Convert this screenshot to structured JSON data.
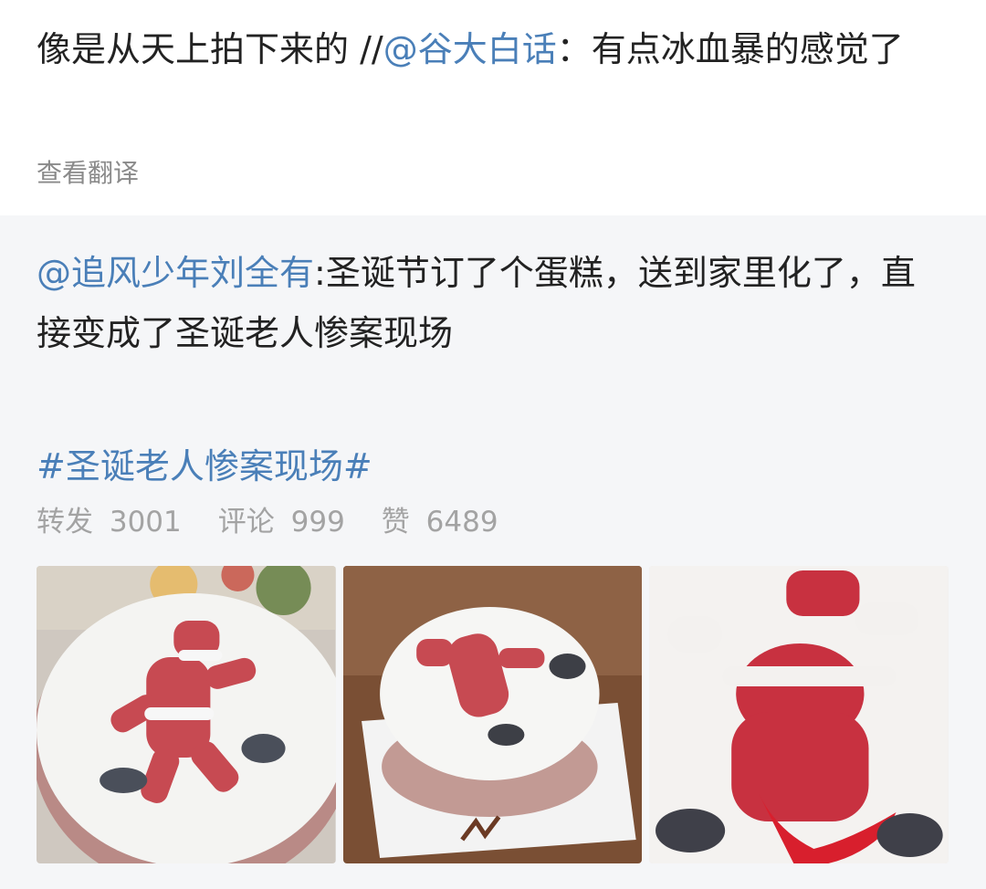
{
  "post": {
    "text": "像是从天上拍下来的 //",
    "mention": "@谷大白话",
    "sep": "：",
    "text2": "有点冰血暴的感觉了",
    "translate": "查看翻译"
  },
  "repost": {
    "author": "@追风少年刘全有",
    "text": ":圣诞节订了个蛋糕，送到家里化了，直接变成了圣诞老人惨案现场",
    "hashtag": "#圣诞老人惨案现场#",
    "stats": {
      "forward_label": "转发",
      "forward_count": "3001",
      "comment_label": "评论",
      "comment_count": "999",
      "like_label": "赞",
      "like_count": "6489"
    },
    "images": [
      {
        "name": "cake-image-1"
      },
      {
        "name": "cake-image-2"
      },
      {
        "name": "cake-image-3"
      }
    ]
  },
  "colors": {
    "link": "#4a7fb8",
    "muted": "#a3a3a3",
    "repost_bg": "#f5f6f8"
  }
}
